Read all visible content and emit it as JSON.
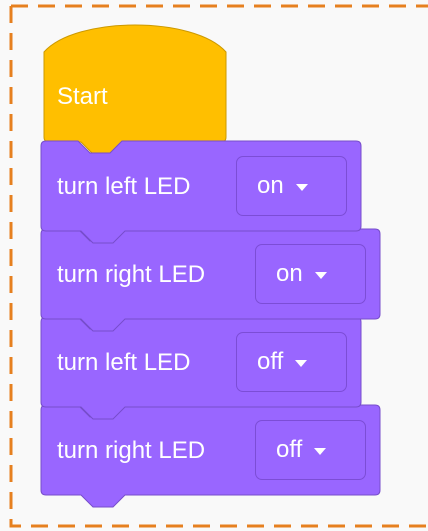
{
  "workspace": {
    "colors": {
      "border": "#e6801f",
      "background": "#f9f9f9",
      "hat_fill": "#ffbf00",
      "hat_stroke": "#cc9900",
      "block_fill": "#9966ff",
      "block_stroke": "#774dcb",
      "text": "#ffffff"
    }
  },
  "start_block": {
    "label": "Start"
  },
  "blocks": [
    {
      "label": "turn left LED",
      "value": "on",
      "dropdown_icon": "caret-down-icon"
    },
    {
      "label": "turn right LED",
      "value": "on",
      "dropdown_icon": "caret-down-icon"
    },
    {
      "label": "turn left LED",
      "value": "off",
      "dropdown_icon": "caret-down-icon"
    },
    {
      "label": "turn right LED",
      "value": "off",
      "dropdown_icon": "caret-down-icon"
    }
  ]
}
